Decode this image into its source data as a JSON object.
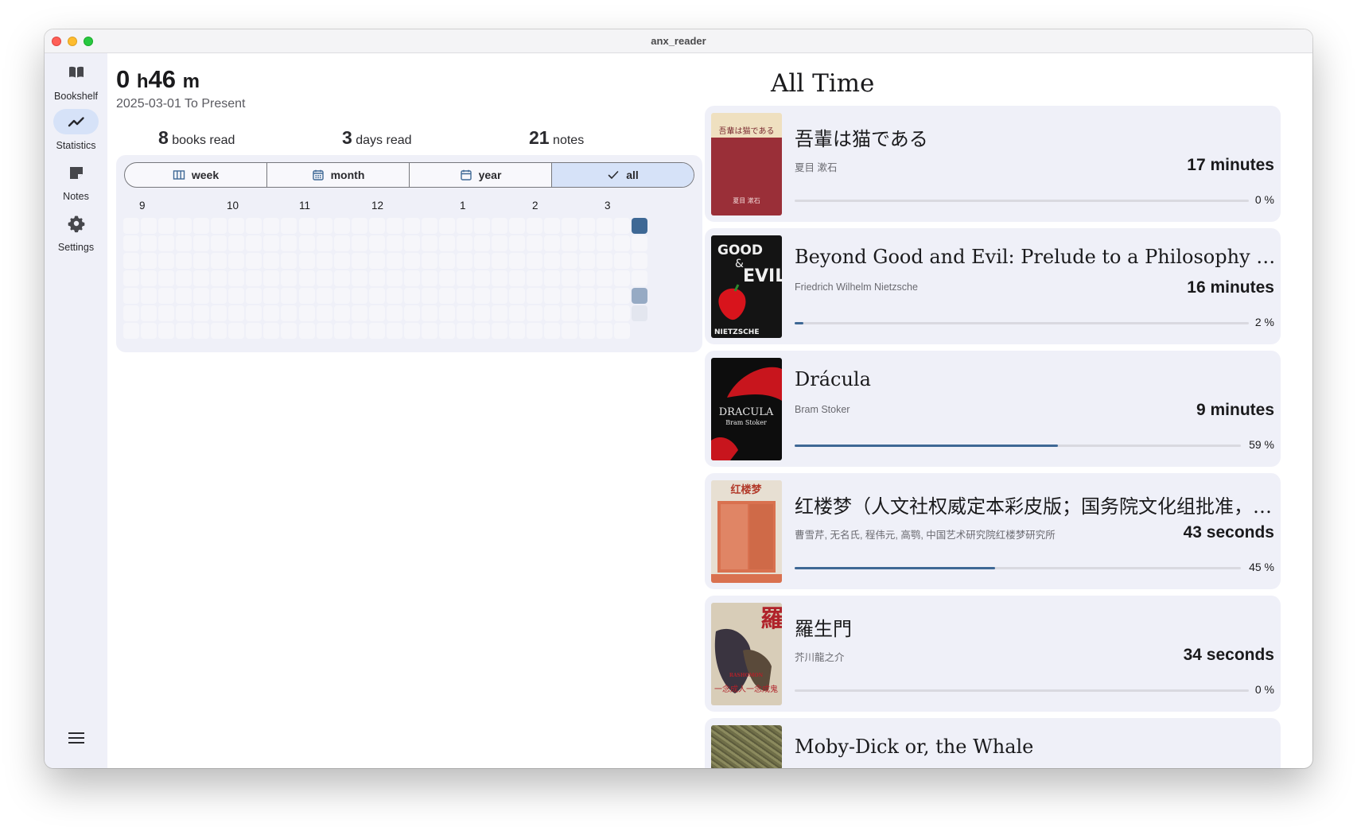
{
  "window": {
    "title": "anx_reader"
  },
  "sidebar": {
    "items": [
      {
        "label": "Bookshelf",
        "icon": "book-open-icon",
        "active": false
      },
      {
        "label": "Statistics",
        "icon": "trending-up-icon",
        "active": true
      },
      {
        "label": "Notes",
        "icon": "note-icon",
        "active": false
      },
      {
        "label": "Settings",
        "icon": "gear-icon",
        "active": false
      }
    ],
    "menu_icon": "hamburger-menu-icon"
  },
  "stats": {
    "total_time": {
      "hours": "0",
      "hours_unit": "h",
      "minutes": "46",
      "minutes_unit": "m"
    },
    "date_range": "2025-03-01 To Present",
    "books_read": {
      "count": "8",
      "label": "books read"
    },
    "days_read": {
      "count": "3",
      "label": "days read"
    },
    "notes": {
      "count": "21",
      "label": "notes"
    },
    "periods": [
      {
        "label": "week",
        "icon": "view-week-icon",
        "selected": false
      },
      {
        "label": "month",
        "icon": "calendar-month-icon",
        "selected": false
      },
      {
        "label": "year",
        "icon": "calendar-icon",
        "selected": false
      },
      {
        "label": "all",
        "icon": "check-icon",
        "selected": true
      }
    ],
    "month_labels": [
      "9",
      "10",
      "11",
      "12",
      "1",
      "2",
      "3"
    ],
    "heatmap": {
      "colors": {
        "empty": "#f6f6fa",
        "level1": "#e3e6ef",
        "level2": "#96aac4",
        "level3": "#3e6895"
      },
      "active_days": [
        {
          "label": "2025-03-01",
          "level": "level3"
        },
        {
          "label": "2025-03-05",
          "level": "level2"
        },
        {
          "label": "2025-03-06",
          "level": "level1"
        }
      ]
    }
  },
  "all_time": {
    "title": "All Time",
    "books": [
      {
        "title": "吾輩は猫である",
        "author": "夏目 漱石",
        "time": "17 minutes",
        "progress": 0,
        "progress_label": "0 %",
        "cover_color": "#9a2f38"
      },
      {
        "title": "Beyond Good and Evil: Prelude to a Philosophy of the Future",
        "author": "Friedrich Wilhelm Nietzsche",
        "time": "16 minutes",
        "progress": 0.02,
        "progress_label": "2 %",
        "cover_color": "#141414"
      },
      {
        "title": "Drácula",
        "author": "Bram Stoker",
        "time": "9 minutes",
        "progress": 0.59,
        "progress_label": "59 %",
        "cover_color": "#0d0d0d"
      },
      {
        "title": "红楼梦（人文社权威定本彩皮版；国务院文化组批准，中国艺术研究院红楼梦研究所校注）",
        "author": "曹雪芹, 无名氏, 程伟元, 高鹗, 中国艺术研究院红楼梦研究所",
        "time": "43 seconds",
        "progress": 0.45,
        "progress_label": "45 %",
        "cover_color": "#d9714f"
      },
      {
        "title": "羅生門",
        "author": "芥川龍之介",
        "time": "34 seconds",
        "progress": 0,
        "progress_label": "0 %",
        "cover_color": "#c8b79a"
      },
      {
        "title": "Moby-Dick or, the Whale",
        "author": "",
        "time": "",
        "progress": 0,
        "progress_label": "",
        "cover_color": "#7a7a55"
      }
    ]
  },
  "theme": {
    "accent": "#3e6895",
    "surface": "#eff0f8",
    "selected": "#d6e2f8"
  }
}
